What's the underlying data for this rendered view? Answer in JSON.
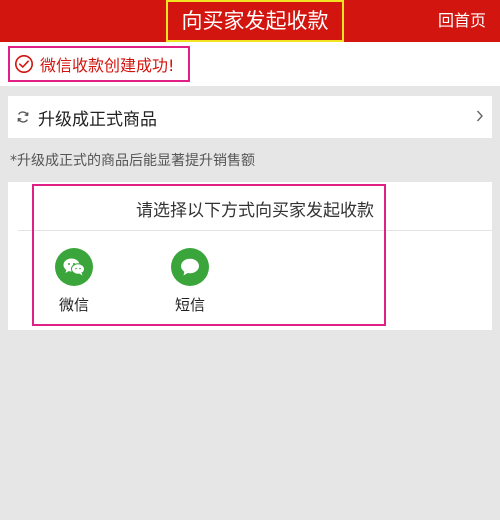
{
  "header": {
    "title": "向买家发起收款",
    "home_label": "回首页"
  },
  "success": {
    "icon": "check-circle-icon",
    "message": "微信收款创建成功!"
  },
  "upgrade": {
    "icon": "refresh-icon",
    "label": "升级成正式商品",
    "chevron": "chevron-right-icon"
  },
  "hint": "*升级成正式的商品后能显著提升销售额",
  "collect": {
    "prompt": "请选择以下方式向买家发起收款",
    "options": [
      {
        "label": "微信",
        "icon": "wechat-icon"
      },
      {
        "label": "短信",
        "icon": "sms-chat-icon"
      }
    ]
  },
  "colors": {
    "brand_red": "#d3150f",
    "highlight_yellow": "#f1e321",
    "highlight_pink": "#e01f87",
    "option_green": "#3aa53a"
  }
}
